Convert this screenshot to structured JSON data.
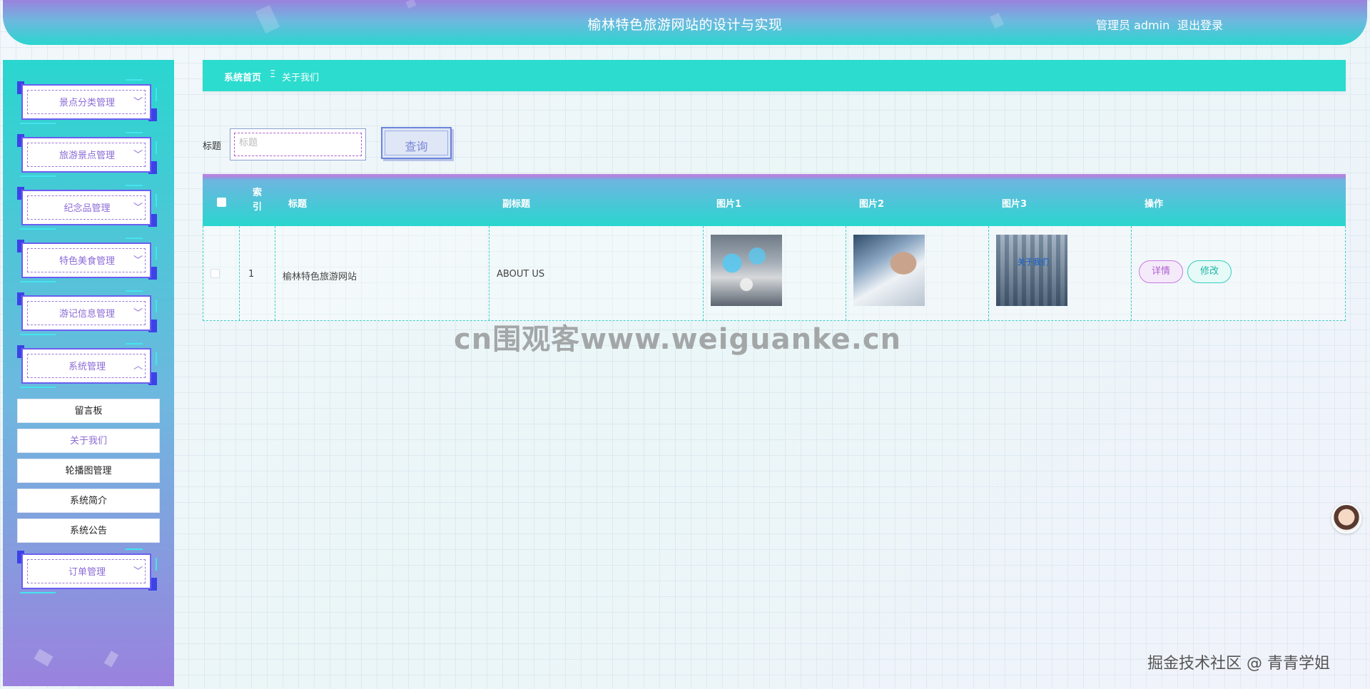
{
  "header": {
    "title": "榆林特色旅游网站的设计与实现",
    "user": "管理员 admin",
    "logout": "退出登录"
  },
  "sidebar": {
    "menus": [
      {
        "label": "景点分类管理",
        "chevron": "﹀",
        "icon": "chevron-down-icon"
      },
      {
        "label": "旅游景点管理",
        "chevron": "﹀",
        "icon": "chevron-down-icon"
      },
      {
        "label": "纪念品管理",
        "chevron": "﹀",
        "icon": "chevron-down-icon"
      },
      {
        "label": "特色美食管理",
        "chevron": "﹀",
        "icon": "chevron-down-icon"
      },
      {
        "label": "游记信息管理",
        "chevron": "﹀",
        "icon": "chevron-down-icon"
      },
      {
        "label": "系统管理",
        "chevron": "︿",
        "icon": "chevron-up-icon"
      },
      {
        "label": "订单管理",
        "chevron": "﹀",
        "icon": "chevron-down-icon"
      }
    ],
    "submenu": [
      {
        "label": "留言板"
      },
      {
        "label": "关于我们",
        "active": true
      },
      {
        "label": "轮播图管理"
      },
      {
        "label": "系统简介"
      },
      {
        "label": "系统公告"
      }
    ]
  },
  "breadcrumb": {
    "home": "系统首页",
    "separator": "Ξ",
    "current": "关于我们"
  },
  "search": {
    "label": "标题",
    "placeholder": "标题",
    "value": "",
    "button": "查询"
  },
  "table": {
    "columns": [
      "索引",
      "标题",
      "副标题",
      "图片1",
      "图片2",
      "图片3",
      "操作"
    ],
    "rows": [
      {
        "index": "1",
        "title": "榆林特色旅游网站",
        "subtitle": "ABOUT US",
        "image3_text": "关于我们",
        "actions": {
          "detail": "详情",
          "edit": "修改"
        }
      }
    ]
  },
  "overlays": {
    "watermark": "cn围观客www.weiguanke.cn",
    "credit": "掘金技术社区 @ 青青学姐"
  },
  "colors": {
    "accent_teal": "#2ad6cf",
    "accent_purple": "#9a82de",
    "menu_text": "#8c6bd6"
  }
}
